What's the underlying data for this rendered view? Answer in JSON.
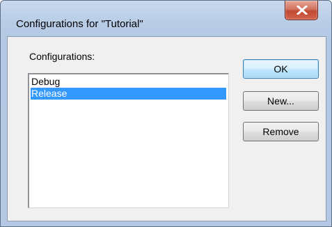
{
  "window": {
    "title": "Configurations for \"Tutorial\"",
    "close_icon": "close-x-icon"
  },
  "dialog": {
    "list_label": "Configurations:",
    "configurations": [
      {
        "label": "Debug",
        "selected": false
      },
      {
        "label": "Release",
        "selected": true
      }
    ],
    "buttons": {
      "ok": "OK",
      "new": "New...",
      "remove": "Remove"
    }
  },
  "colors": {
    "selection": "#3399ff",
    "titlebar": "#b9cde7",
    "close_button": "#c14a32"
  }
}
